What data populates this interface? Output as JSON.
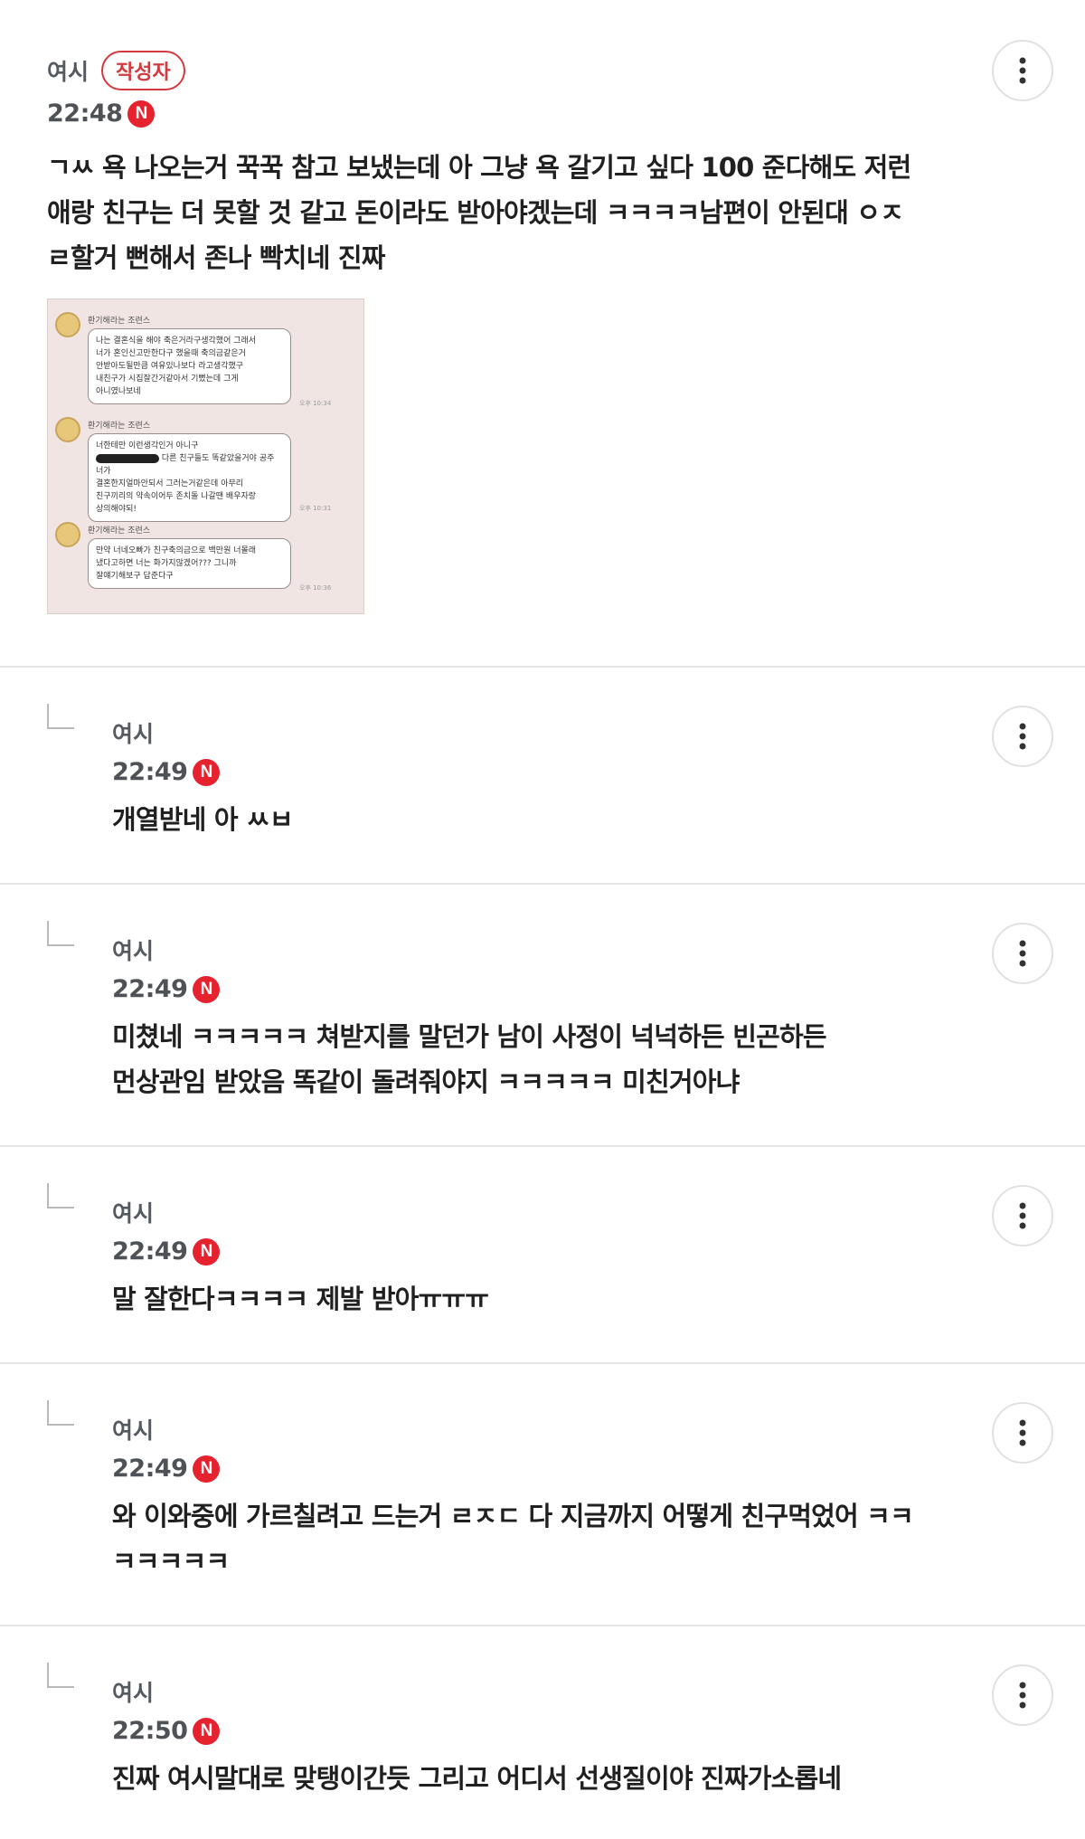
{
  "comments": [
    {
      "author": "여시",
      "writer_badge": "작성자",
      "time": "22:48",
      "new_badge": "N",
      "lines": [
        "ㄱㅆ 욕 나오는거 꾹꾹 참고 보냈는데 아 그냥 욕 갈기고 싶다 100 준다해도 저런",
        "애랑 친구는 더 못할 것 같고 돈이라도 받아야겠는데 ㅋㅋㅋㅋ남편이 안된대 ㅇㅈ",
        "ㄹ할거 뻔해서 존나 빡치네 진짜"
      ],
      "attachment": {
        "chat_name": "환기해라는 조련스",
        "messages": [
          {
            "lines": [
              "나는 결혼식을 해야 축은거라구생각했어 그래서",
              "너가 혼인신고만한다구 했을때 축의금같은거",
              "안받아도될만큼 여유있나보다 라고생각했구",
              "내친구가 시집잘간거같아서 기뻤는데 그게",
              "아니였나보네"
            ],
            "time": "오후 10:34"
          },
          {
            "lines": [
              "너한테만 이런생각인거 아니구",
              "다른 친구들도 똑같았을거야 공주 너가",
              "결혼한지얼마안되서 그러는거같은데 아무리",
              "친구끼리의 약속이어두 존치돌 나갈땐 배우자랑",
              "상의해야되!"
            ],
            "time": "오후 10:31"
          },
          {
            "lines": [
              "만약 너네오빠가 친구축의금으로 백만원 너몰래",
              "냈다고하면 너는 화가지않겠어??? 그니까",
              "잘얘기해보구 답준다구"
            ],
            "time": "오후 10:36"
          }
        ]
      }
    },
    {
      "author": "여시",
      "time": "22:49",
      "new_badge": "N",
      "lines": [
        "개열받네 아 ㅆㅂ"
      ]
    },
    {
      "author": "여시",
      "time": "22:49",
      "new_badge": "N",
      "lines": [
        "미쳤네 ㅋㅋㅋㅋㅋ 쳐받지를 말던가 남이 사정이 넉넉하든 빈곤하든",
        "먼상관임 받았음 똑같이 돌려줘야지 ㅋㅋㅋㅋㅋ 미친거아냐"
      ]
    },
    {
      "author": "여시",
      "time": "22:49",
      "new_badge": "N",
      "lines": [
        "말 잘한다ㅋㅋㅋㅋ 제발 받아ㅠㅠㅠ"
      ]
    },
    {
      "author": "여시",
      "time": "22:49",
      "new_badge": "N",
      "lines": [
        "와 이와중에 가르칠려고 드는거 ㄹㅈㄷ 다 지금까지 어떻게 친구먹었어 ㅋㅋ",
        "ㅋㅋㅋㅋㅋ"
      ]
    },
    {
      "author": "여시",
      "time": "22:50",
      "new_badge": "N",
      "lines": [
        "진짜 여시말대로 맞탱이간듯 그리고 어디서 선생질이야 진짜가소롭네"
      ]
    }
  ]
}
